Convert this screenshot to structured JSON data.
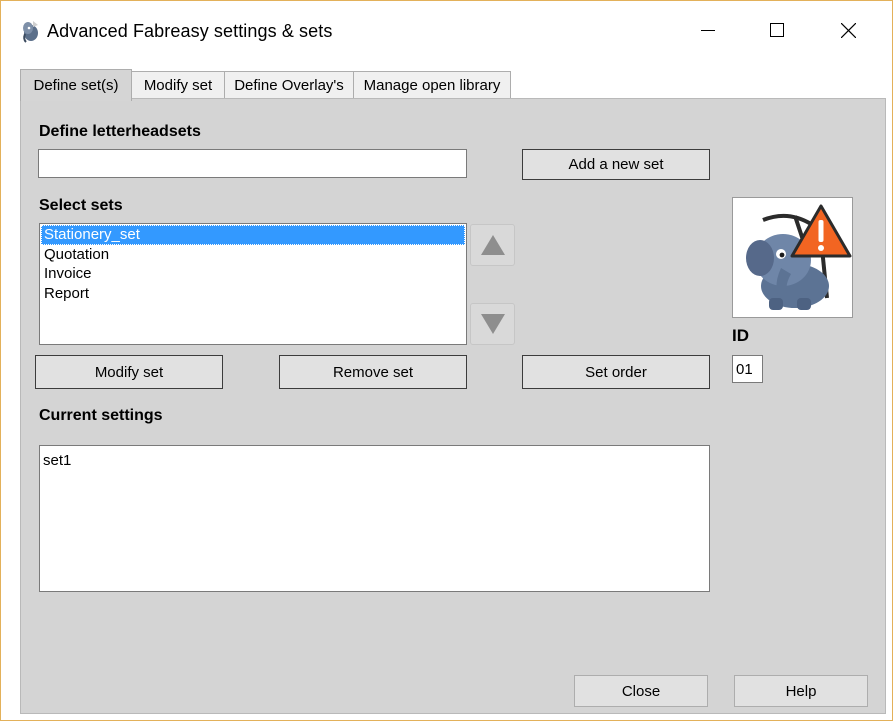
{
  "window": {
    "title": "Advanced Fabreasy settings & sets",
    "border_color": "#e3b15a"
  },
  "tabs": [
    {
      "label": "Define set(s)",
      "active": true
    },
    {
      "label": "Modify set",
      "active": false
    },
    {
      "label": "Define Overlay's",
      "active": false
    },
    {
      "label": "Manage open library",
      "active": false
    }
  ],
  "define_section": {
    "label": "Define letterheadsets",
    "input_value": "",
    "add_button": "Add a new set"
  },
  "select_section": {
    "label": "Select sets",
    "items": [
      {
        "label": "Stationery_set",
        "selected": true
      },
      {
        "label": "Quotation",
        "selected": false
      },
      {
        "label": "Invoice",
        "selected": false
      },
      {
        "label": "Report",
        "selected": false
      }
    ],
    "selection_color": "#3399ff"
  },
  "buttons": {
    "modify": "Modify set",
    "remove": "Remove set",
    "set_order": "Set order",
    "close": "Close",
    "help": "Help"
  },
  "id_section": {
    "label": "ID",
    "value": "01"
  },
  "current_settings": {
    "label": "Current settings",
    "content": "set1"
  },
  "icons": {
    "app": "elephant-app-icon",
    "warning_image": "elephant-warning-sign-icon"
  },
  "colors": {
    "tabpage_bg": "#d4d4d4",
    "button_bg": "#e1e1e1",
    "warning_orange": "#f26522"
  }
}
